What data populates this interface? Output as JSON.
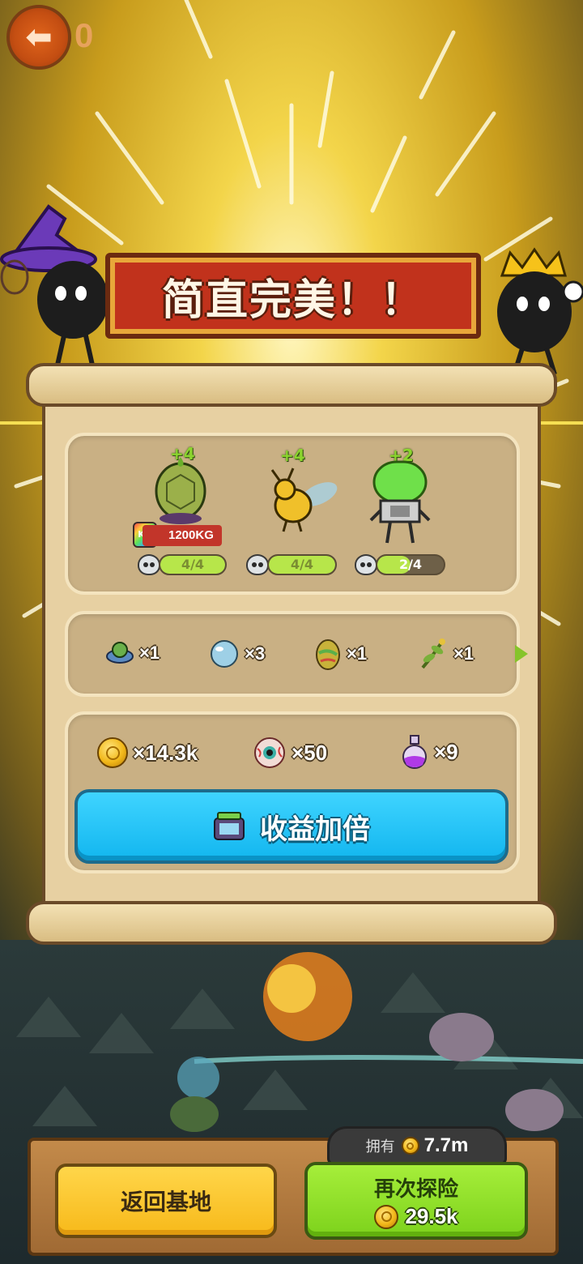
{
  "header": {
    "back_icon": "arrow-left-icon",
    "counter": "0"
  },
  "banner": {
    "title": "简直完美！！"
  },
  "creatures": [
    {
      "name_icon": "turtle-shell-creature-icon",
      "bonus": "+4",
      "progress": "4/4",
      "progress_fraction": 1.0
    },
    {
      "name_icon": "bee-creature-icon",
      "bonus": "+4",
      "progress": "4/4",
      "progress_fraction": 1.0
    },
    {
      "name_icon": "robot-jar-creature-icon",
      "bonus": "+2",
      "progress": "2/4",
      "progress_fraction": 0.5
    }
  ],
  "weight_badge": {
    "label": "KG",
    "value": "1200KG"
  },
  "items": [
    {
      "icon": "ufo-creature-icon",
      "count": "×1"
    },
    {
      "icon": "crystal-orb-icon",
      "count": "×3"
    },
    {
      "icon": "egg-icon",
      "count": "×1"
    },
    {
      "icon": "herb-icon",
      "count": "×1"
    }
  ],
  "rewards": [
    {
      "icon": "coin-icon",
      "count": "×14.3k"
    },
    {
      "icon": "eyeball-icon",
      "count": "×50"
    },
    {
      "icon": "potion-icon",
      "count": "×9"
    }
  ],
  "double_button": {
    "label": "收益加倍",
    "icon": "video-tv-icon"
  },
  "owned": {
    "label": "拥有",
    "value": "7.7m"
  },
  "buttons": {
    "home": "返回基地",
    "again": "再次探险",
    "again_cost": "29.5k"
  },
  "colors": {
    "accent_blue": "#12b6ef",
    "accent_green": "#7dd21c",
    "accent_yellow": "#f7b91a",
    "banner_red": "#c1321c"
  }
}
